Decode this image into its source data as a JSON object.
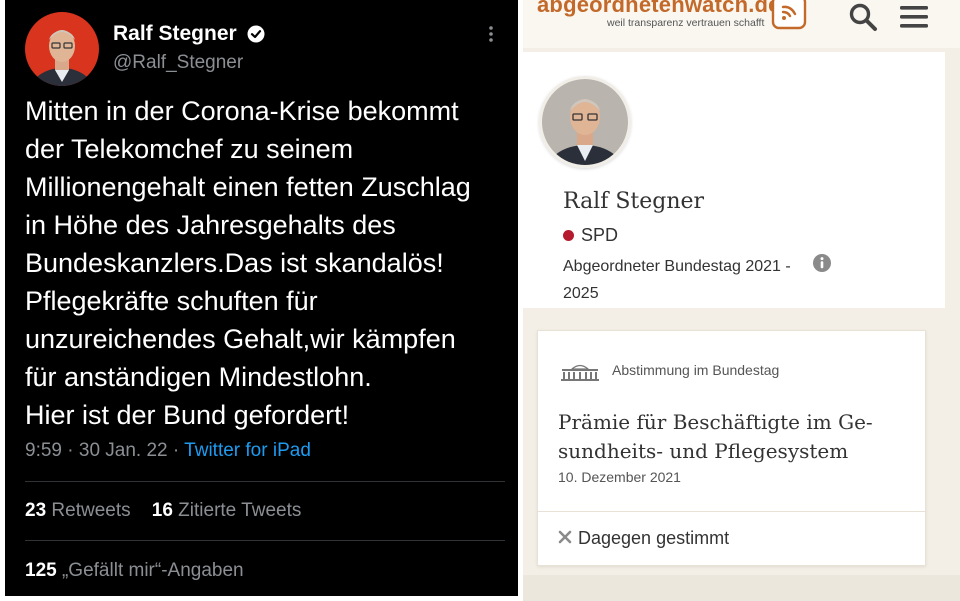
{
  "tweet": {
    "author_name": "Ralf Stegner",
    "handle": "@Ralf_Stegner",
    "text_lines": [
      "Mitten in der Corona-Krise bekommt",
      "der Telekomchef zu seinem",
      "Millionengehalt einen fetten Zuschlag",
      "in Höhe des Jahresgehalts des",
      "Bundeskanzlers.Das ist skandalös!",
      "Pflegekräfte schuften für",
      "unzureichendes Gehalt,wir kämpfen",
      "für anständigen Mindestlohn.",
      "Hier ist der Bund gefordert!"
    ],
    "time": "9:59",
    "date": "30 Jan. 22",
    "dot": "·",
    "source": "Twitter for iPad",
    "retweets_count": "23",
    "retweets_label": "Retweets",
    "quotes_count": "16",
    "quotes_label": "Zitierte Tweets",
    "likes_count": "125",
    "likes_label": "„Gefällt mir“-Angaben",
    "colors": {
      "background": "#000000",
      "link": "#1d9bf0",
      "muted": "#8b8f94"
    }
  },
  "aw": {
    "logo_text": "abgeordnetenwatch.de",
    "tagline": "weil transparenz vertrauen schafft",
    "profile": {
      "name": "Ralf Stegner",
      "party": "SPD",
      "mandate_line1": "Abgeordneter Bundestag 2021 -",
      "mandate_line2": "2025"
    },
    "card": {
      "category": "Abstimmung im Bundestag",
      "title_line1": "Prämie für Beschäftigte im Ge-",
      "title_line2": "sundheits- und Pflegesystem",
      "date": "10. Dezember 2021",
      "vote": "Dagegen gestimmt"
    },
    "colors": {
      "brand": "#c36a2a",
      "party": "#b51a2e",
      "vote_x": "#8a8a8a"
    }
  }
}
